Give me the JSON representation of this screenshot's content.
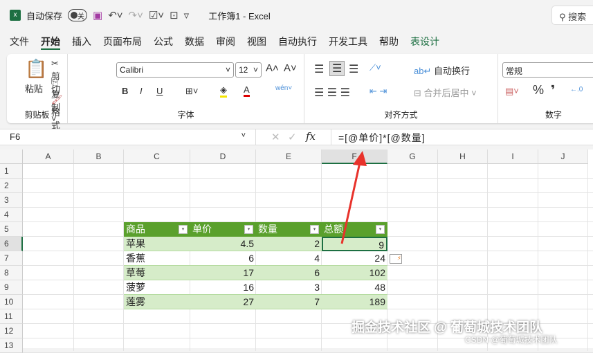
{
  "titlebar": {
    "autosave_label": "自动保存",
    "autosave_state": "关",
    "doc_title": "工作簿1  -  Excel",
    "search_placeholder": "搜索"
  },
  "tabs": [
    "文件",
    "开始",
    "插入",
    "页面布局",
    "公式",
    "数据",
    "审阅",
    "视图",
    "自动执行",
    "开发工具",
    "帮助",
    "表设计"
  ],
  "ribbon": {
    "clipboard": {
      "paste": "粘贴",
      "cut": "剪切",
      "copy": "复制",
      "format_painter": "格式刷",
      "label": "剪贴板"
    },
    "font": {
      "name": "Calibri",
      "size": "12",
      "bold": "B",
      "italic": "I",
      "underline": "U",
      "label": "字体"
    },
    "alignment": {
      "wrap": "自动换行",
      "merge": "合并后居中",
      "label": "对齐方式"
    },
    "number": {
      "format": "常规",
      "percent": "%",
      "comma": "❜",
      "label": "数字"
    }
  },
  "formula_bar": {
    "name_box": "F6",
    "fx": "fx",
    "formula": "=[@单价]*[@数量]"
  },
  "columns": [
    "A",
    "B",
    "C",
    "D",
    "E",
    "F",
    "G",
    "H",
    "I",
    "J"
  ],
  "rows": [
    "1",
    "2",
    "3",
    "4",
    "5",
    "6",
    "7",
    "8",
    "9",
    "10",
    "11",
    "12",
    "13"
  ],
  "table": {
    "headers": [
      "商品",
      "单价",
      "数量",
      "总额"
    ],
    "rows": [
      [
        "苹果",
        "4.5",
        "2",
        "9"
      ],
      [
        "香蕉",
        "6",
        "4",
        "24"
      ],
      [
        "草莓",
        "17",
        "6",
        "102"
      ],
      [
        "菠萝",
        "16",
        "3",
        "48"
      ],
      [
        "莲雾",
        "27",
        "7",
        "189"
      ]
    ]
  },
  "colors": {
    "header": "#5aa02c",
    "band": "#d6ecc9",
    "accent": "#1d6f42",
    "arrow": "#e8322b"
  },
  "watermark": {
    "main": "掘金技术社区 @ 葡萄城技术团队",
    "sub": "CSDN @葡萄城技术团队"
  }
}
